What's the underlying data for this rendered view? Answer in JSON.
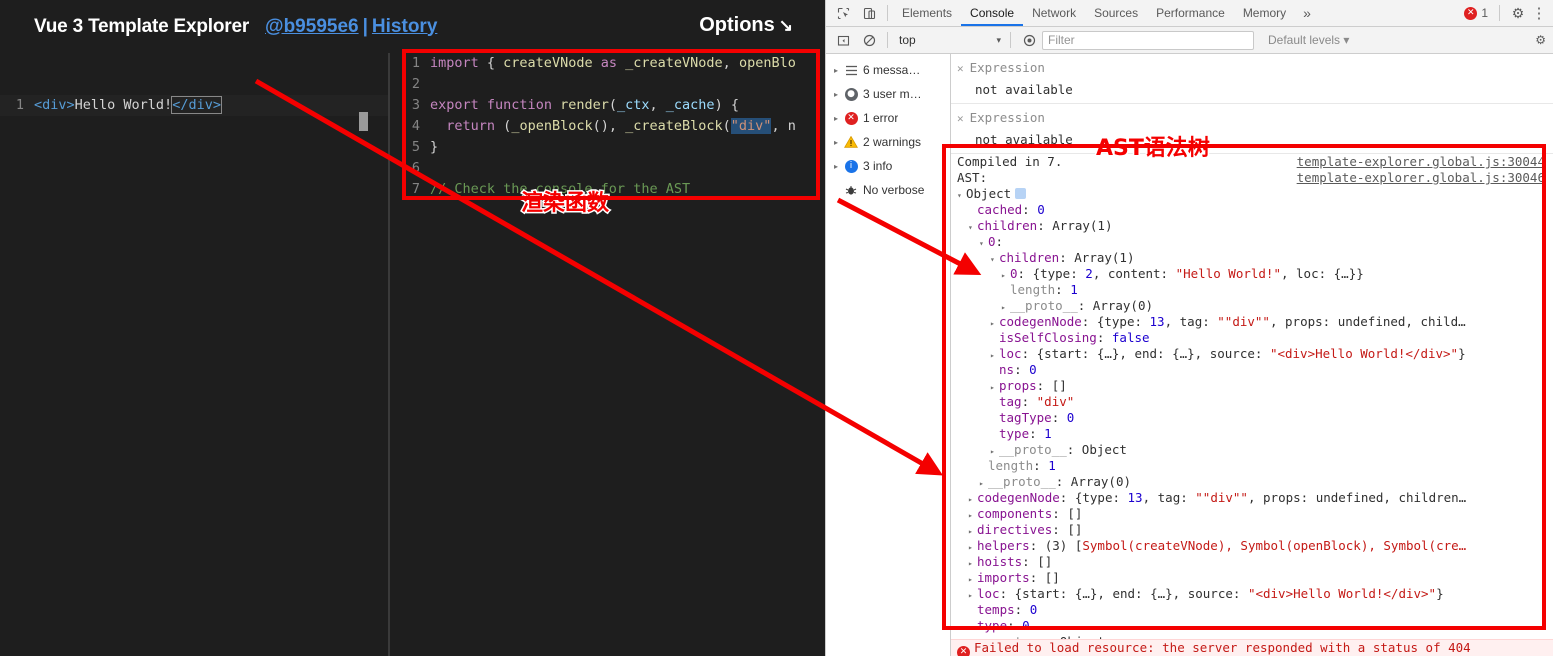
{
  "explorer": {
    "title": "Vue 3 Template Explorer",
    "version_link": "@b9595e6",
    "separator": "|",
    "history_link": "History",
    "options_label": "Options",
    "options_arrow": "↘",
    "template_editor": {
      "line_number": "1",
      "tokens": {
        "open_tag": "<div>",
        "text": "Hello World!",
        "close_tag": "</div>"
      }
    },
    "output_editor": {
      "lines": [
        {
          "n": "1",
          "text": "import { createVNode as _createVNode, openBlo"
        },
        {
          "n": "2",
          "text": ""
        },
        {
          "n": "3",
          "text": "export function render(_ctx, _cache) {"
        },
        {
          "n": "4",
          "text": "  return (_openBlock(), _createBlock(\"div\", n"
        },
        {
          "n": "5",
          "text": "}"
        },
        {
          "n": "6",
          "text": ""
        },
        {
          "n": "7",
          "text": "// Check the console for the AST"
        }
      ]
    }
  },
  "devtools": {
    "tabs": [
      {
        "label": "Elements",
        "active": false
      },
      {
        "label": "Console",
        "active": true
      },
      {
        "label": "Network",
        "active": false
      },
      {
        "label": "Sources",
        "active": false
      },
      {
        "label": "Performance",
        "active": false
      },
      {
        "label": "Memory",
        "active": false
      }
    ],
    "more_tabs_glyph": "»",
    "error_badge": {
      "glyph": "✕",
      "count": "1"
    },
    "settings_glyph": "⚙",
    "menu_glyph": "⋮",
    "inspect_icon": "inspect-element-icon",
    "device_icon": "device-toolbar-icon",
    "filterbar": {
      "sidebar_toggle_glyph": "◨",
      "clear_glyph": "⊘",
      "context": "top",
      "context_caret": "▾",
      "eye_glyph": "◉",
      "filter_placeholder": "Filter",
      "filter_value": "",
      "levels_label": "Default levels",
      "levels_caret": "▾",
      "edge_glyph": "⚙"
    },
    "sidebar": [
      {
        "tri": "▸",
        "icon": "list-icon",
        "label": "6 messa…"
      },
      {
        "tri": "▸",
        "icon": "user-icon",
        "label": "3 user m…"
      },
      {
        "tri": "▸",
        "icon": "error-icon",
        "label": "1 error"
      },
      {
        "tri": "▸",
        "icon": "warning-icon",
        "label": "2 warnings"
      },
      {
        "tri": "▸",
        "icon": "info-icon",
        "label": "3 info"
      },
      {
        "tri": "",
        "icon": "verbose-icon",
        "label": "No verbose"
      }
    ],
    "messages": [
      {
        "x": "✕",
        "line1": "Expression",
        "line2": "not available"
      },
      {
        "x": "✕",
        "line1": "Expression",
        "line2": "not available"
      }
    ],
    "compiled_line": {
      "text": "Compiled in 7.",
      "link": "template-explorer.global.js:30044"
    },
    "ast_header": {
      "text": "AST:",
      "link": "template-explorer.global.js:30046"
    },
    "ast_tree": [
      {
        "indent": 0,
        "tri": "▾",
        "parts": [
          {
            "t": "Object",
            "c": "obj"
          }
        ],
        "badge": true
      },
      {
        "indent": 1,
        "tri": "",
        "parts": [
          {
            "t": "cached",
            "c": "name"
          },
          {
            "t": ": ",
            "c": "plain"
          },
          {
            "t": "0",
            "c": "num"
          }
        ]
      },
      {
        "indent": 1,
        "tri": "▾",
        "parts": [
          {
            "t": "children",
            "c": "name"
          },
          {
            "t": ": ",
            "c": "plain"
          },
          {
            "t": "Array(1)",
            "c": "plain"
          }
        ]
      },
      {
        "indent": 2,
        "tri": "▾",
        "parts": [
          {
            "t": "0",
            "c": "name"
          },
          {
            "t": ":",
            "c": "plain"
          }
        ]
      },
      {
        "indent": 3,
        "tri": "▾",
        "parts": [
          {
            "t": "children",
            "c": "name"
          },
          {
            "t": ": ",
            "c": "plain"
          },
          {
            "t": "Array(1)",
            "c": "plain"
          }
        ]
      },
      {
        "indent": 4,
        "tri": "▸",
        "parts": [
          {
            "t": "0",
            "c": "name"
          },
          {
            "t": ": {",
            "c": "plain"
          },
          {
            "t": "type",
            "c": "plain"
          },
          {
            "t": ": ",
            "c": "plain"
          },
          {
            "t": "2",
            "c": "num"
          },
          {
            "t": ", content: ",
            "c": "plain"
          },
          {
            "t": "\"Hello World!\"",
            "c": "str"
          },
          {
            "t": ", loc: {…}}",
            "c": "plain"
          }
        ]
      },
      {
        "indent": 4,
        "tri": "",
        "parts": [
          {
            "t": "length",
            "c": "grey"
          },
          {
            "t": ": ",
            "c": "plain"
          },
          {
            "t": "1",
            "c": "num"
          }
        ]
      },
      {
        "indent": 4,
        "tri": "▸",
        "parts": [
          {
            "t": "__proto__",
            "c": "grey"
          },
          {
            "t": ": ",
            "c": "plain"
          },
          {
            "t": "Array(0)",
            "c": "plain"
          }
        ]
      },
      {
        "indent": 3,
        "tri": "▸",
        "parts": [
          {
            "t": "codegenNode",
            "c": "name"
          },
          {
            "t": ": {type: ",
            "c": "plain"
          },
          {
            "t": "13",
            "c": "num"
          },
          {
            "t": ", tag: ",
            "c": "plain"
          },
          {
            "t": "\"\"div\"\"",
            "c": "str"
          },
          {
            "t": ", props: undefined, child…",
            "c": "plain"
          }
        ]
      },
      {
        "indent": 3,
        "tri": "",
        "parts": [
          {
            "t": "isSelfClosing",
            "c": "name"
          },
          {
            "t": ": ",
            "c": "plain"
          },
          {
            "t": "false",
            "c": "bool"
          }
        ]
      },
      {
        "indent": 3,
        "tri": "▸",
        "parts": [
          {
            "t": "loc",
            "c": "name"
          },
          {
            "t": ": {start: {…}, end: {…}, source: ",
            "c": "plain"
          },
          {
            "t": "\"<div>Hello World!</div>\"",
            "c": "str"
          },
          {
            "t": "}",
            "c": "plain"
          }
        ]
      },
      {
        "indent": 3,
        "tri": "",
        "parts": [
          {
            "t": "ns",
            "c": "name"
          },
          {
            "t": ": ",
            "c": "plain"
          },
          {
            "t": "0",
            "c": "num"
          }
        ]
      },
      {
        "indent": 3,
        "tri": "▸",
        "parts": [
          {
            "t": "props",
            "c": "name"
          },
          {
            "t": ": []",
            "c": "plain"
          }
        ]
      },
      {
        "indent": 3,
        "tri": "",
        "parts": [
          {
            "t": "tag",
            "c": "name"
          },
          {
            "t": ": ",
            "c": "plain"
          },
          {
            "t": "\"div\"",
            "c": "str"
          }
        ]
      },
      {
        "indent": 3,
        "tri": "",
        "parts": [
          {
            "t": "tagType",
            "c": "name"
          },
          {
            "t": ": ",
            "c": "plain"
          },
          {
            "t": "0",
            "c": "num"
          }
        ]
      },
      {
        "indent": 3,
        "tri": "",
        "parts": [
          {
            "t": "type",
            "c": "name"
          },
          {
            "t": ": ",
            "c": "plain"
          },
          {
            "t": "1",
            "c": "num"
          }
        ]
      },
      {
        "indent": 3,
        "tri": "▸",
        "parts": [
          {
            "t": "__proto__",
            "c": "grey"
          },
          {
            "t": ": ",
            "c": "plain"
          },
          {
            "t": "Object",
            "c": "plain"
          }
        ]
      },
      {
        "indent": 2,
        "tri": "",
        "parts": [
          {
            "t": "length",
            "c": "grey"
          },
          {
            "t": ": ",
            "c": "plain"
          },
          {
            "t": "1",
            "c": "num"
          }
        ]
      },
      {
        "indent": 2,
        "tri": "▸",
        "parts": [
          {
            "t": "__proto__",
            "c": "grey"
          },
          {
            "t": ": ",
            "c": "plain"
          },
          {
            "t": "Array(0)",
            "c": "plain"
          }
        ]
      },
      {
        "indent": 1,
        "tri": "▸",
        "parts": [
          {
            "t": "codegenNode",
            "c": "name"
          },
          {
            "t": ": {type: ",
            "c": "plain"
          },
          {
            "t": "13",
            "c": "num"
          },
          {
            "t": ", tag: ",
            "c": "plain"
          },
          {
            "t": "\"\"div\"\"",
            "c": "str"
          },
          {
            "t": ", props: undefined, children…",
            "c": "plain"
          }
        ]
      },
      {
        "indent": 1,
        "tri": "▸",
        "parts": [
          {
            "t": "components",
            "c": "name"
          },
          {
            "t": ": []",
            "c": "plain"
          }
        ]
      },
      {
        "indent": 1,
        "tri": "▸",
        "parts": [
          {
            "t": "directives",
            "c": "name"
          },
          {
            "t": ": []",
            "c": "plain"
          }
        ]
      },
      {
        "indent": 1,
        "tri": "▸",
        "parts": [
          {
            "t": "helpers",
            "c": "name"
          },
          {
            "t": ": (3) [",
            "c": "plain"
          },
          {
            "t": "Symbol(createVNode), Symbol(openBlock), Symbol(cre…",
            "c": "str"
          }
        ]
      },
      {
        "indent": 1,
        "tri": "▸",
        "parts": [
          {
            "t": "hoists",
            "c": "name"
          },
          {
            "t": ": []",
            "c": "plain"
          }
        ]
      },
      {
        "indent": 1,
        "tri": "▸",
        "parts": [
          {
            "t": "imports",
            "c": "name"
          },
          {
            "t": ": []",
            "c": "plain"
          }
        ]
      },
      {
        "indent": 1,
        "tri": "▸",
        "parts": [
          {
            "t": "loc",
            "c": "name"
          },
          {
            "t": ": {start: {…}, end: {…}, source: ",
            "c": "plain"
          },
          {
            "t": "\"<div>Hello World!</div>\"",
            "c": "str"
          },
          {
            "t": "}",
            "c": "plain"
          }
        ]
      },
      {
        "indent": 1,
        "tri": "",
        "parts": [
          {
            "t": "temps",
            "c": "name"
          },
          {
            "t": ": ",
            "c": "plain"
          },
          {
            "t": "0",
            "c": "num"
          }
        ]
      },
      {
        "indent": 1,
        "tri": "",
        "parts": [
          {
            "t": "type",
            "c": "name"
          },
          {
            "t": ": ",
            "c": "plain"
          },
          {
            "t": "0",
            "c": "num"
          }
        ]
      },
      {
        "indent": 1,
        "tri": "▸",
        "parts": [
          {
            "t": "__proto__",
            "c": "grey"
          },
          {
            "t": ": ",
            "c": "plain"
          },
          {
            "t": "Object",
            "c": "plain"
          }
        ]
      }
    ],
    "bottom_error": "Failed to load resource: the server responded with a status of 404"
  },
  "annotations": {
    "render_fn_label": "渲染函数",
    "ast_label": "AST语法树",
    "accent_color": "#f40000"
  }
}
